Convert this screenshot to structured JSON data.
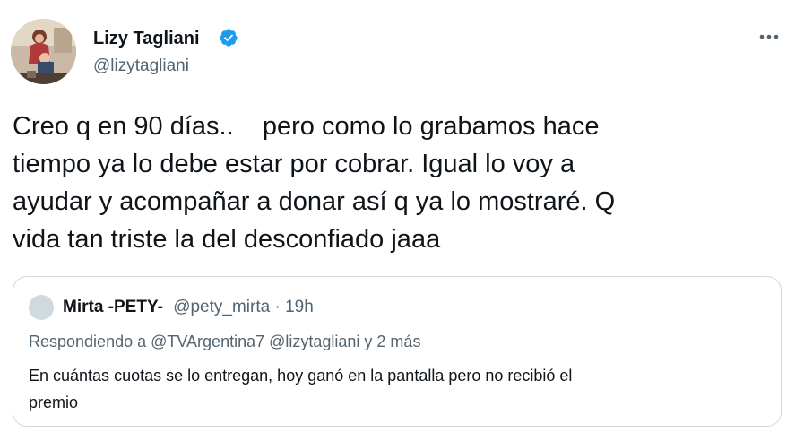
{
  "author": {
    "name": "Lizy Tagliani",
    "handle": "@lizytagliani",
    "verified": true,
    "avatar_icon": "profile-photo"
  },
  "more_icon": "more-options-icon",
  "tweet": {
    "text_lines": [
      "Creo q en 90 días..    pero como lo grabamos hace",
      "tiempo ya lo debe estar por cobrar. Igual lo voy a",
      "ayudar y acompañar a donar así q ya lo mostraré. Q",
      "vida tan triste la del desconfiado jaaa"
    ]
  },
  "quoted": {
    "name": "Mirta -PETY-",
    "handle": "@pety_mirta",
    "separator": " · ",
    "time": "19h",
    "replying_to": "Respondiendo a @TVArgentina7 @lizytagliani y 2 más",
    "text_lines": [
      "En cuántas cuotas se lo entregan, hoy ganó en la pantalla pero no recibió el",
      "premio"
    ]
  },
  "colors": {
    "text": "#0f1419",
    "secondary": "#536471",
    "border": "#cfd9de",
    "verified": "#1d9bf0"
  }
}
